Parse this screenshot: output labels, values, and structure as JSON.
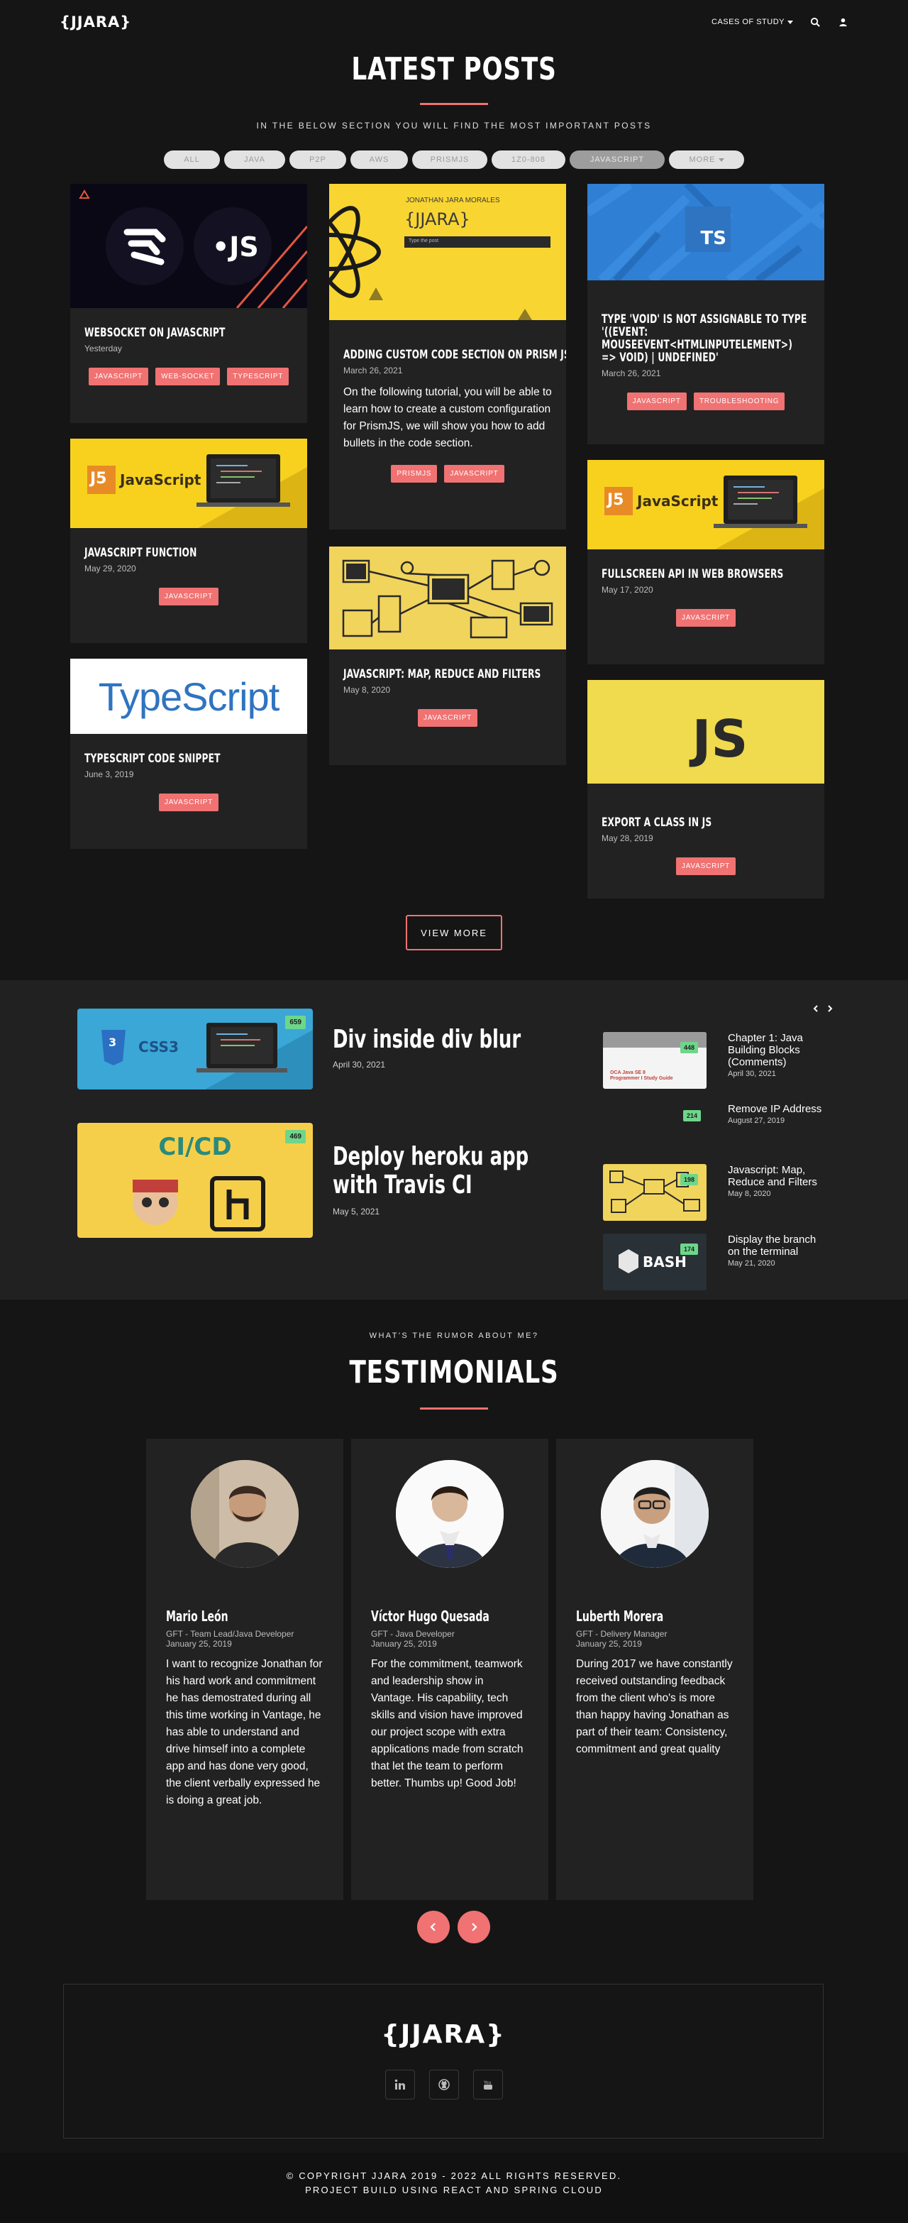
{
  "navbar": {
    "brand": "{JJARA}",
    "cases_label": "CASES OF STUDY"
  },
  "latest": {
    "title": "LATEST POSTS",
    "subtitle": "IN THE BELOW SECTION YOU WILL FIND THE MOST IMPORTANT POSTS",
    "filters": [
      "ALL",
      "JAVA",
      "P2P",
      "AWS",
      "PRISMJS",
      "1Z0-808",
      "JAVASCRIPT",
      "MORE"
    ],
    "active_filter": "JAVASCRIPT",
    "view_more": "VIEW MORE"
  },
  "posts": [
    {
      "title": "WEBSOCKET ON JAVASCRIPT",
      "date": "Yesterday",
      "tags": [
        "JAVASCRIPT",
        "WEB-SOCKET",
        "TYPESCRIPT"
      ],
      "image": "websocket-js"
    },
    {
      "title": "ADDING CUSTOM CODE SECTION ON PRISM JS",
      "date": "March 26, 2021",
      "excerpt": "On the following tutorial, you will be able to learn how to create a custom configuration for PrismJS, we will show you how to add bullets in the code section.",
      "tags": [
        "PRISMJS",
        "JAVASCRIPT"
      ],
      "image": "prism-react",
      "image_caption_top": "JONATHAN JARA MORALES",
      "image_brand": "{JJARA}",
      "image_search": "Type the post"
    },
    {
      "title": "TYPE 'VOID' IS NOT ASSIGNABLE TO TYPE '((EVENT: MOUSEEVENT<HTMLINPUTELEMENT>) => VOID) | UNDEFINED'",
      "date": "March 26, 2021",
      "tags": [
        "JAVASCRIPT",
        "TROUBLESHOOTING"
      ],
      "image": "ts-blue",
      "image_text": "TS"
    },
    {
      "title": "JAVASCRIPT FUNCTION",
      "date": "May 29, 2020",
      "tags": [
        "JAVASCRIPT"
      ],
      "image": "js-laptop",
      "image_text": "JavaScript"
    },
    {
      "title": "JAVASCRIPT: MAP, REDUCE AND FILTERS",
      "date": "May 8, 2020",
      "tags": [
        "JAVASCRIPT"
      ],
      "image": "yellow-devices"
    },
    {
      "title": "FULLSCREEN API IN WEB BROWSERS",
      "date": "May 17, 2020",
      "tags": [
        "JAVASCRIPT"
      ],
      "image": "js-laptop",
      "image_text": "JavaScript"
    },
    {
      "title": "TYPESCRIPT CODE SNIPPET",
      "date": "June 3, 2019",
      "tags": [
        "JAVASCRIPT"
      ],
      "image": "typescript-logo",
      "image_text": "TypeScript"
    },
    {
      "title": "EXPORT A CLASS IN JS",
      "date": "May 28, 2019",
      "tags": [
        "JAVASCRIPT"
      ],
      "image": "js-yellow",
      "image_text": "JS"
    }
  ],
  "featured": {
    "main": [
      {
        "title": "Div inside div blur",
        "date": "April 30, 2021",
        "views": "659",
        "image_text": "CSS3"
      },
      {
        "title": "Deploy heroku app with Travis CI",
        "date": "May 5, 2021",
        "views": "469",
        "image_text": "CI/CD"
      }
    ],
    "side": [
      {
        "title": "Chapter 1: Java Building Blocks (Comments)",
        "date": "April 30, 2021",
        "views": "448",
        "image_text": "OCA Java SE 8 Programmer I Study Guide"
      },
      {
        "title": "Remove IP Address",
        "date": "August 27, 2019",
        "views": "214"
      },
      {
        "title": "Javascript: Map, Reduce and Filters",
        "date": "May 8, 2020",
        "views": "198"
      },
      {
        "title": "Display the branch on the terminal",
        "date": "May 21, 2020",
        "views": "174",
        "image_text": "BASH"
      }
    ]
  },
  "testimonials": {
    "kicker": "WHAT'S THE RUMOR ABOUT ME?",
    "title": "TESTIMONIALS",
    "items": [
      {
        "name": "Mario León",
        "role": "GFT - Team Lead/Java Developer",
        "date": "January 25, 2019",
        "text": "I want to recognize Jonathan for his hard work and commitment he has demostrated during all this time working in Vantage, he has able to understand and drive himself into a complete app and has done very good, the client verbally expressed he is doing a great job."
      },
      {
        "name": "Víctor Hugo Quesada",
        "role": "GFT - Java Developer",
        "date": "January 25, 2019",
        "text": "For the commitment, teamwork and leadership show in Vantage. His capability, tech skills and vision have improved our project scope with extra applications made from scratch that let the team to perform better. Thumbs up! Good Job!"
      },
      {
        "name": "Luberth Morera",
        "role": "GFT - Delivery Manager",
        "date": "January 25, 2019",
        "text": "During 2017 we have constantly received outstanding feedback from the client who's is more than happy having Jonathan as part of their team: Consistency, commitment and great quality"
      }
    ]
  },
  "footer": {
    "brand": "{JJARA}",
    "copyright": "© COPYRIGHT JJARA 2019 - 2022 ALL RIGHTS RESERVED.",
    "built_with": "PROJECT BUILD USING REACT AND SPRING CLOUD",
    "social": [
      "linkedin-icon",
      "github-icon",
      "youtube-icon"
    ]
  },
  "colors": {
    "accent": "#f07272",
    "background": "#151515",
    "card": "#222222",
    "badge": "#6ed68a"
  }
}
